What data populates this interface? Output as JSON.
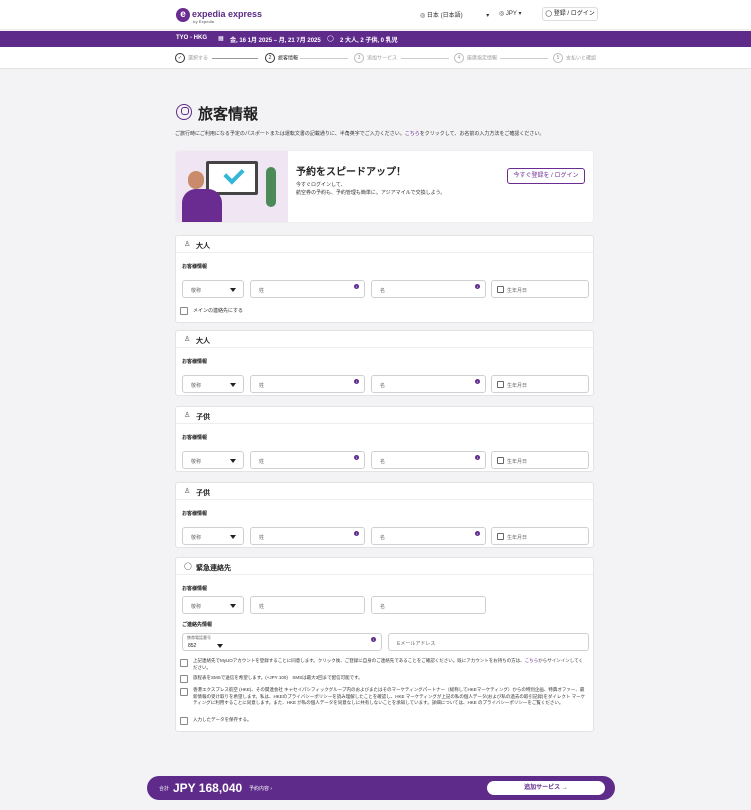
{
  "header": {
    "logo_text": "expedia express",
    "logo_sub": "by Expedia",
    "language": "日本 (日本語)",
    "currency": "JPY",
    "login": "登録 / ログイン"
  },
  "trip": {
    "route": "TYO - HKG",
    "dates": "金, 16 1月 2025 – 月, 21 7月 2025",
    "pax": "2 大人, 2 子供, 0 乳児"
  },
  "steps": [
    {
      "num": "✓",
      "label": "選択する"
    },
    {
      "num": "2",
      "label": "旅客情報"
    },
    {
      "num": "3",
      "label": "追加サービス"
    },
    {
      "num": "4",
      "label": "座席指定情報"
    },
    {
      "num": "5",
      "label": "支払いと確認"
    }
  ],
  "page": {
    "title": "旅客情報",
    "notice_pre": "ご旅行時にご利用になる予定のパスポートまたは運転文書の記載通りに、半角英字でご入力ください。",
    "notice_link": "こちら",
    "notice_post": "をクリックして、お名前の入力方法をご確認ください。"
  },
  "promo": {
    "title": "予約をスピードアップ！",
    "line1": "今すぐログインして、",
    "line2": "航空券の予約も、予約管理も簡単に。アジアマイルで交換しよう。",
    "button": "今すぐ登録を / ログイン"
  },
  "passengers": [
    {
      "type": "大人",
      "section": "お客様情報",
      "title_ph": "敬称",
      "last_ph": "姓",
      "first_ph": "名",
      "dob_ph": "生年月日",
      "primary": "メインの連絡先にする"
    },
    {
      "type": "大人",
      "section": "お客様情報",
      "title_ph": "敬称",
      "last_ph": "姓",
      "first_ph": "名",
      "dob_ph": "生年月日"
    },
    {
      "type": "子供",
      "section": "お客様情報",
      "title_ph": "敬称",
      "last_ph": "姓",
      "first_ph": "名",
      "dob_ph": "生年月日"
    },
    {
      "type": "子供",
      "section": "お客様情報",
      "title_ph": "敬称",
      "last_ph": "姓",
      "first_ph": "名",
      "dob_ph": "生年月日"
    }
  ],
  "emergency": {
    "title": "緊急連絡先",
    "section": "お客様情報",
    "title_ph": "敬称",
    "last_ph": "姓",
    "first_ph": "名",
    "contact_section": "ご連絡先情報",
    "phone_label": "携帯電話番号",
    "phone_code": "852",
    "email_ph": "Eメールアドレス",
    "consent1_pre": "上記連絡先でMyUOアカウントを登録することに同意します。クリック後、ご登録に自身のご連絡先であることをご確認ください。既にアカウントをお持ちの方は、",
    "consent1_link": "こちら",
    "consent1_post": "からサインインしてください。",
    "consent2": "旅程表をSMSで送信を希望します。(+JPY 100)　SMSは最大3回まで配信可能です。",
    "consent3": "香港エクスプレス航空 (HKE)、その関連会社 キャセイパシフィックグループ内のおよびまたはそのマーケティングパートナー（総称してHKEマーケティング）からの特別企画、特典オファー、最新情報の受け取りを希望します。私は、HKEのプライバシーポリシーを読み理解したことを確認し、HKE マーケティングが上記の私の個人データ(および私の過去の取引記録)をダイレクト マーケティングに利用することに同意します。また、HKE が私の個人データを同意なしに共有しないことを承知しています。詳細については、HKE のプライバシーポリシーをご覧ください。",
    "consent4": "入力したデータを保存する。"
  },
  "footer": {
    "total_label": "合計",
    "total": "JPY 168,040",
    "details": "予約内容 ›",
    "next": "追加サービス →"
  },
  "colors": {
    "brand": "#5e2b8a",
    "accent": "#6a2c91"
  }
}
